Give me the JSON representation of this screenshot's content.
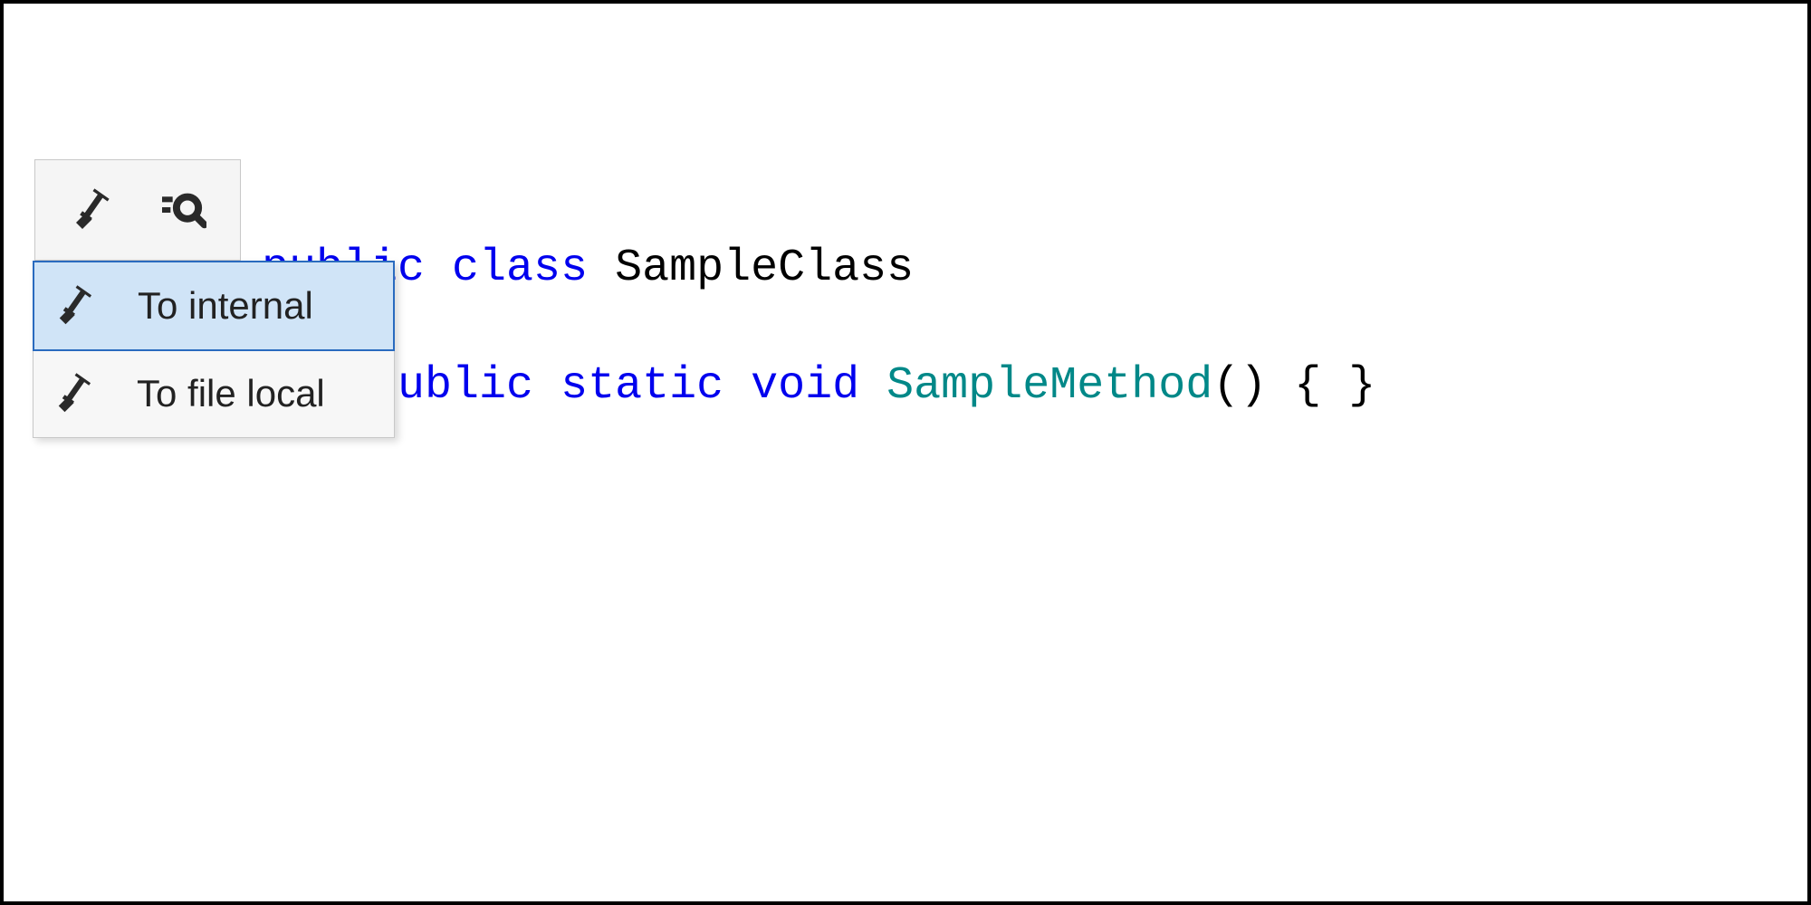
{
  "code": {
    "line1": {
      "kw1": "public",
      "kw2": "class",
      "name": "SampleClass"
    },
    "line2": "{",
    "line3": {
      "indent": "    ",
      "kw1": "public",
      "kw2": "static",
      "kw3": "void",
      "method": "SampleMethod",
      "tail": "() { }"
    }
  },
  "menu": {
    "item1": "To internal",
    "item2": "To file local"
  }
}
